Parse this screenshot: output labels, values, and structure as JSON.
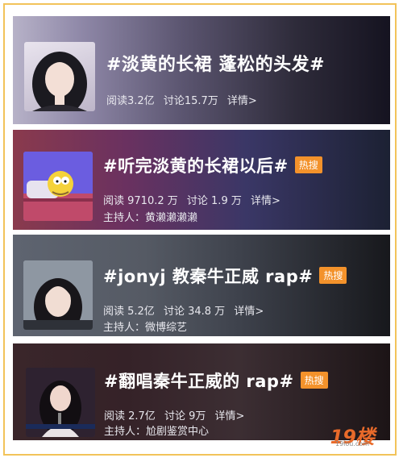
{
  "topics": [
    {
      "title": "#淡黄的长裙 蓬松的头发#",
      "badge": "",
      "read": "阅读3.2亿",
      "discuss": "讨论15.7万",
      "details": "详情>",
      "host": ""
    },
    {
      "title": "#听完淡黄的长裙以后#",
      "badge": "热搜",
      "read": "阅读 9710.2 万",
      "discuss": "讨论 1.9 万",
      "details": "详情>",
      "host": "主持人：黄濑濑濑濑"
    },
    {
      "title": "#jonyj 教秦牛正威 rap#",
      "badge": "热搜",
      "read": "阅读 5.2亿",
      "discuss": "讨论 34.8 万",
      "details": "详情>",
      "host": "主持人：微博综艺"
    },
    {
      "title": "#翻唱秦牛正威的 rap#",
      "badge": "热搜",
      "read": "阅读 2.7亿",
      "discuss": "讨论 9万",
      "details": "详情>",
      "host": "主持人：尬剧鉴赏中心"
    }
  ],
  "watermark": {
    "big": "19楼",
    "small": "19lou.com"
  },
  "colors": {
    "badge": "#f3922b",
    "frame": "#f2c35a"
  }
}
